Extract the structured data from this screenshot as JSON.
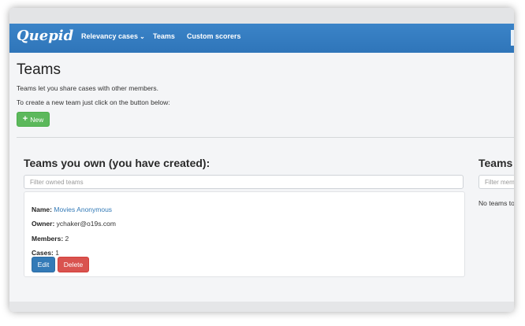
{
  "navbar": {
    "brand": "Quepid",
    "items": [
      {
        "label": "Relevancy cases",
        "chevron": "⌄"
      },
      {
        "label": "Teams"
      },
      {
        "label": "Custom scorers"
      }
    ]
  },
  "page": {
    "title": "Teams",
    "intro_line1": "Teams let you share cases with other members.",
    "intro_line2": "To create a new team just click on the button below:",
    "new_button_icon": "+",
    "new_button_label": "New"
  },
  "owned": {
    "title": "Teams you own (you have created):",
    "filter_placeholder": "Filter owned teams",
    "team": {
      "name_label": "Name:",
      "name_value": "Movies Anonymous",
      "owner_label": "Owner:",
      "owner_value": "ychaker@o19s.com",
      "members_label": "Members:",
      "members_value": "2",
      "cases_label": "Cases:",
      "cases_value": "1",
      "edit_label": "Edit",
      "delete_label": "Delete"
    }
  },
  "member": {
    "title": "Teams",
    "filter_placeholder": "Filter mem",
    "empty_text": "No teams to"
  },
  "colors": {
    "navbar": "#2f75b9",
    "new_button": "#5cb85c",
    "edit_button": "#337ab7",
    "delete_button": "#d9534f",
    "link": "#337ab7"
  }
}
